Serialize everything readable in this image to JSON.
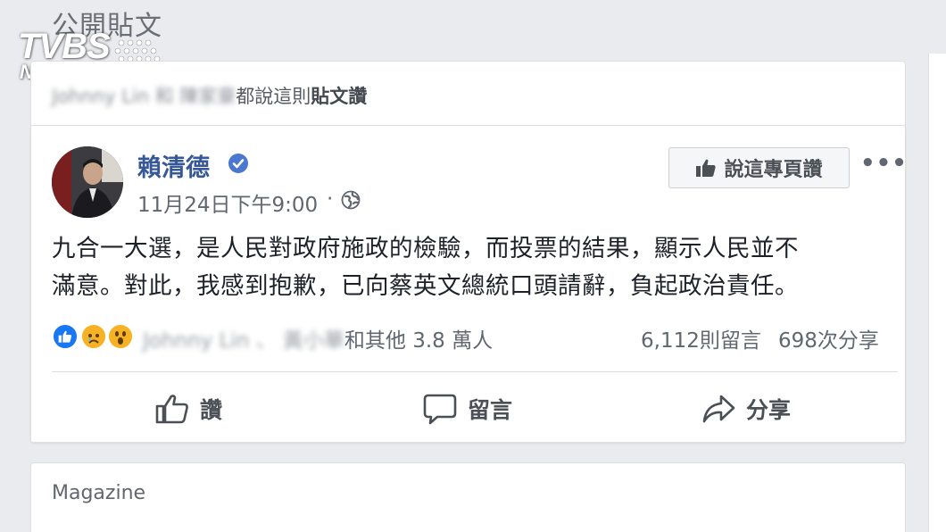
{
  "section": {
    "title": "公開貼文"
  },
  "watermark": {
    "main": "TVBS",
    "sub": "NEWS"
  },
  "like_context": {
    "blurred_names": "Johnny Lin 和 陳家豪",
    "suffix": "都說這則",
    "bold": "貼文讚"
  },
  "post": {
    "author": "賴清德",
    "verified_icon": "verified-badge-icon",
    "timestamp": "11月24日下午9:00",
    "separator": "·",
    "privacy_icon": "globe-icon",
    "like_page_label": "說這專頁讚",
    "more_label": "•••",
    "text_line1": "九合一大選，是人民對政府施政的檢驗，而投票的結果，顯示人民並不",
    "text_line2": "滿意。對此，我感到抱歉，已向蔡英文總統口頭請辭，負起政治責任。"
  },
  "reactions": {
    "types": [
      "like",
      "sad",
      "wow"
    ],
    "blurred_names": "Johnny Lin 、 黃小華",
    "others": "和其他 3.8 萬人",
    "comments": "6,112則留言",
    "shares": "698次分享"
  },
  "actions": {
    "like_label": "讚",
    "comment_label": "留言",
    "share_label": "分享"
  },
  "next_card": {
    "label": "Magazine"
  },
  "colors": {
    "link_blue": "#365899",
    "like_blue": "#1877f2",
    "reaction_yellow": "#f7b125",
    "background": "#e9ebee"
  }
}
